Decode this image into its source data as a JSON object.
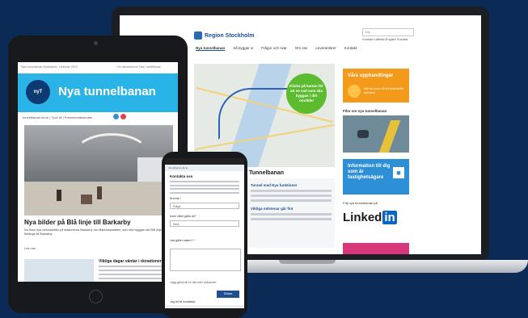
{
  "laptop": {
    "logo": "Region Stockholm",
    "search_placeholder": "Sök",
    "top_links": "Kontakt  Lättläst  English  Sociala",
    "nav": [
      "Nya tunnelbanan",
      "Så bygger vi",
      "Frågor och svar",
      "Om oss",
      "Leverantörer",
      "Kontakt"
    ],
    "map_bubble": "Klicka på kartan för att se vad som ska byggas i ditt område!",
    "heading": "Tunnelbanan",
    "card_title": "Tunnel med Nya funktioner",
    "card_title2": "Viktiga milstenar går fint",
    "orange_title": "Våra upphandlingar",
    "orange_sub": "Allt du som vill bli leverantör behöver",
    "film_title": "Film om nya tunnelbanan",
    "info_title": "Information till dig som är fastighetsägare",
    "follow": "Följ nya tunnelbanan på",
    "linkedin_a": "Linked",
    "linkedin_b": "in"
  },
  "tablet": {
    "topbar_left": "Nya tunnelbanan  Nyhetsbrev  1 februari 2019",
    "topbar_right": "Om nyhetsbrevet  Visa i webbläsare",
    "badge": "nyT",
    "banner_title": "Nya tunnelbanan",
    "links": "tunnelbanan.sll.se  |  Tyck till  |  Pressmeddelanden",
    "headline": "Nya bilder på Blå linje till Barkarby",
    "intro": "Nu finns nya visionsbilder på stationerna Barkarby och Barkarbystaden, som ska byggas när Blå linje förlängs till Barkarby.",
    "more": "Läs mer",
    "card_title": "Viktiga dagar väntar i donationer"
  },
  "phone": {
    "url": "tunnelbanan.sll.se",
    "heading": "Kontakta oss",
    "label1": "Ärende *",
    "field1": "Fråga",
    "label2": "Inom vilket gälla de?",
    "field2": "Skriv",
    "label3": "Vad gäller saken? *",
    "submit_text": "Lägg gärna till en bild eller dokument",
    "submit": "Skicka",
    "check": "Jag vill bli kontaktad"
  }
}
